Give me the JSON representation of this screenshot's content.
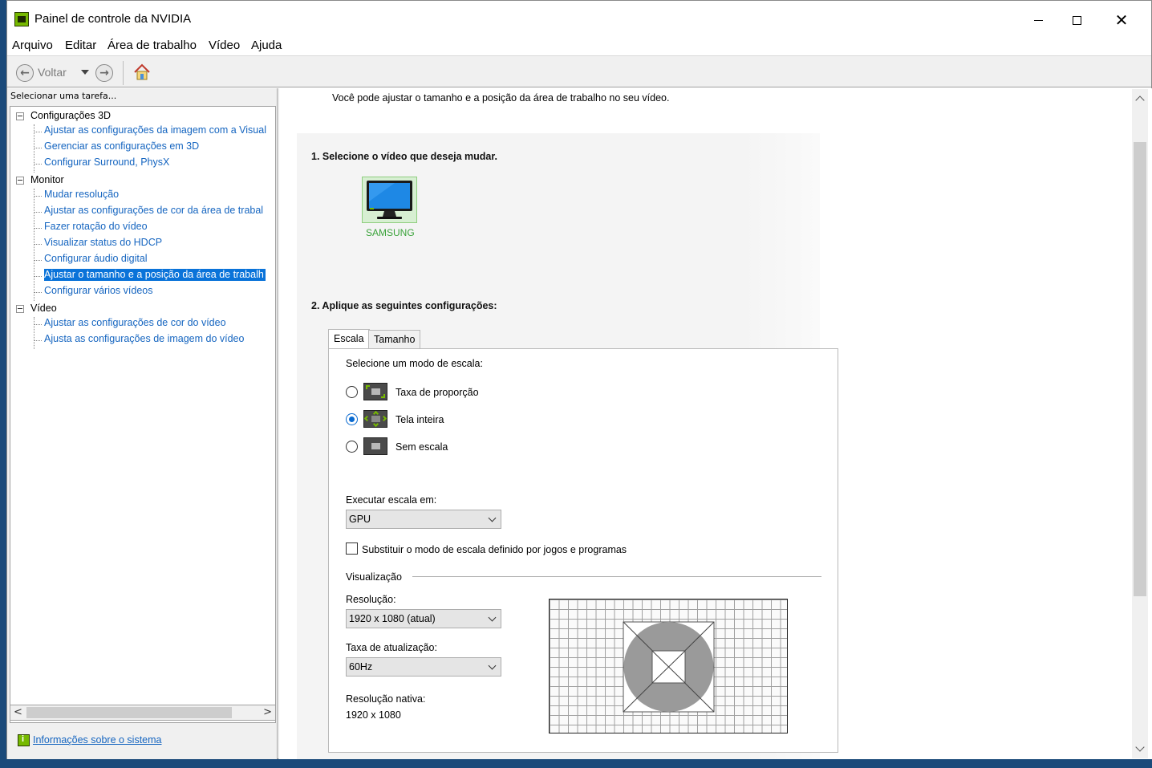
{
  "window": {
    "title": "Painel de controle da NVIDIA",
    "controls": [
      "minimize",
      "maximize",
      "close"
    ]
  },
  "menu": [
    "Arquivo",
    "Editar",
    "Área de trabalho",
    "Vídeo",
    "Ajuda"
  ],
  "toolbar": {
    "back_label": "Voltar",
    "icons": [
      "back-arrow-icon",
      "dropdown-icon",
      "forward-arrow-icon",
      "home-icon"
    ]
  },
  "sidebar": {
    "task_label": "Selecionar uma tarefa...",
    "groups": [
      {
        "label": "Configurações 3D",
        "items": [
          "Ajustar as configurações da imagem com a Visual",
          "Gerenciar as configurações em 3D",
          "Configurar Surround, PhysX"
        ]
      },
      {
        "label": "Monitor",
        "items": [
          "Mudar resolução",
          "Ajustar as configurações de cor da área de trabal",
          "Fazer rotação do vídeo",
          "Visualizar status do HDCP",
          "Configurar áudio digital",
          "Ajustar o tamanho e a posição da área de trabalh",
          "Configurar vários vídeos"
        ]
      },
      {
        "label": "Vídeo",
        "items": [
          "Ajustar as configurações de cor do vídeo",
          "Ajusta as configurações de imagem do vídeo"
        ]
      }
    ],
    "selected_item": "Ajustar o tamanho e a posição da área de trabalh",
    "system_info_link": "Informações sobre o sistema"
  },
  "main": {
    "intro": "Você pode ajustar o tamanho e a posição da área de trabalho no seu vídeo.",
    "step1_title": "1. Selecione o vídeo que deseja mudar.",
    "display_name": "SAMSUNG",
    "step2_title": "2. Aplique as seguintes configurações:",
    "tabs": [
      "Escala",
      "Tamanho"
    ],
    "active_tab": "Escala",
    "scale_mode_label": "Selecione um modo de escala:",
    "scale_modes": [
      "Taxa de proporção",
      "Tela inteira",
      "Sem escala"
    ],
    "selected_scale_mode": "Tela inteira",
    "perform_scaling_label": "Executar escala em:",
    "perform_scaling_value": "GPU",
    "override_checkbox_label": "Substituir o modo de escala definido por jogos e programas",
    "override_checked": false,
    "preview_group_label": "Visualização",
    "resolution_label": "Resolução:",
    "resolution_value": "1920 x 1080 (atual)",
    "refresh_label": "Taxa de atualização:",
    "refresh_value": "60Hz",
    "native_label": "Resolução nativa:",
    "native_value": "1920 x 1080"
  },
  "colors": {
    "nvidia_green": "#76b900",
    "link_blue": "#1565c0",
    "selection_blue": "#0a73d9",
    "display_label_green": "#3ba33b"
  }
}
